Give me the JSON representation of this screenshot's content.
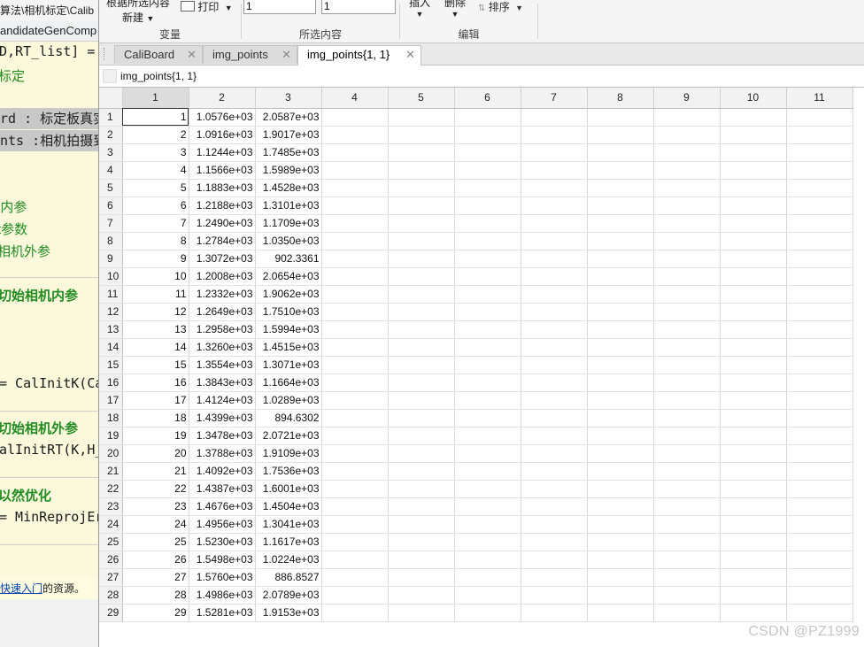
{
  "editor": {
    "breadcrumb": "算法\\相机标定\\Calib",
    "file_tab": "andidateGenComp",
    "code_line_1": "D,RT_list] =",
    "code_line_2": "标定",
    "code_line_3": "rd : 标定板真实",
    "code_line_4": "nts :相机拍摄到",
    "code_line_5": "l内参",
    "code_line_6": "t参数",
    "code_line_7": "  相机外参",
    "section_1": "切始相机内参",
    "code_line_8": "= CalInitK(Cali",
    "section_2": "切始相机外参",
    "code_line_9": "alInitRT(K,H_li",
    "section_3": "以然优化",
    "code_line_10": " = MinReprojErr",
    "footer_link": "快速入门",
    "footer_text": "的资源。"
  },
  "ribbon": {
    "new_from_selection": "根据所选内容",
    "new_label": "新建",
    "print_label": "打印",
    "input_row_value": "1",
    "input_col_value": "1",
    "insert_label": "插入",
    "delete_label": "删除",
    "sort_label": "排序",
    "group_variable": "变量",
    "group_selection": "所选内容",
    "group_edit": "编辑"
  },
  "tabs": [
    {
      "label": "CaliBoard"
    },
    {
      "label": "img_points"
    },
    {
      "label": "img_points{1, 1}"
    }
  ],
  "infobar": {
    "variable_name": "img_points{1, 1}"
  },
  "grid": {
    "column_headers": [
      "1",
      "2",
      "3",
      "4",
      "5",
      "6",
      "7",
      "8",
      "9",
      "10",
      "11"
    ],
    "rows": [
      [
        "1",
        "1",
        "1.0576e+03",
        "2.0587e+03"
      ],
      [
        "2",
        "2",
        "1.0916e+03",
        "1.9017e+03"
      ],
      [
        "3",
        "3",
        "1.1244e+03",
        "1.7485e+03"
      ],
      [
        "4",
        "4",
        "1.1566e+03",
        "1.5989e+03"
      ],
      [
        "5",
        "5",
        "1.1883e+03",
        "1.4528e+03"
      ],
      [
        "6",
        "6",
        "1.2188e+03",
        "1.3101e+03"
      ],
      [
        "7",
        "7",
        "1.2490e+03",
        "1.1709e+03"
      ],
      [
        "8",
        "8",
        "1.2784e+03",
        "1.0350e+03"
      ],
      [
        "9",
        "9",
        "1.3072e+03",
        "902.3361"
      ],
      [
        "10",
        "10",
        "1.2008e+03",
        "2.0654e+03"
      ],
      [
        "11",
        "11",
        "1.2332e+03",
        "1.9062e+03"
      ],
      [
        "12",
        "12",
        "1.2649e+03",
        "1.7510e+03"
      ],
      [
        "13",
        "13",
        "1.2958e+03",
        "1.5994e+03"
      ],
      [
        "14",
        "14",
        "1.3260e+03",
        "1.4515e+03"
      ],
      [
        "15",
        "15",
        "1.3554e+03",
        "1.3071e+03"
      ],
      [
        "16",
        "16",
        "1.3843e+03",
        "1.1664e+03"
      ],
      [
        "17",
        "17",
        "1.4124e+03",
        "1.0289e+03"
      ],
      [
        "18",
        "18",
        "1.4399e+03",
        "894.6302"
      ],
      [
        "19",
        "19",
        "1.3478e+03",
        "2.0721e+03"
      ],
      [
        "20",
        "20",
        "1.3788e+03",
        "1.9109e+03"
      ],
      [
        "21",
        "21",
        "1.4092e+03",
        "1.7536e+03"
      ],
      [
        "22",
        "22",
        "1.4387e+03",
        "1.6001e+03"
      ],
      [
        "23",
        "23",
        "1.4676e+03",
        "1.4504e+03"
      ],
      [
        "24",
        "24",
        "1.4956e+03",
        "1.3041e+03"
      ],
      [
        "25",
        "25",
        "1.5230e+03",
        "1.1617e+03"
      ],
      [
        "26",
        "26",
        "1.5498e+03",
        "1.0224e+03"
      ],
      [
        "27",
        "27",
        "1.5760e+03",
        "886.8527"
      ],
      [
        "28",
        "28",
        "1.4986e+03",
        "2.0789e+03"
      ],
      [
        "29",
        "29",
        "1.5281e+03",
        "1.9153e+03"
      ]
    ]
  },
  "watermark": "CSDN @PZ1999"
}
